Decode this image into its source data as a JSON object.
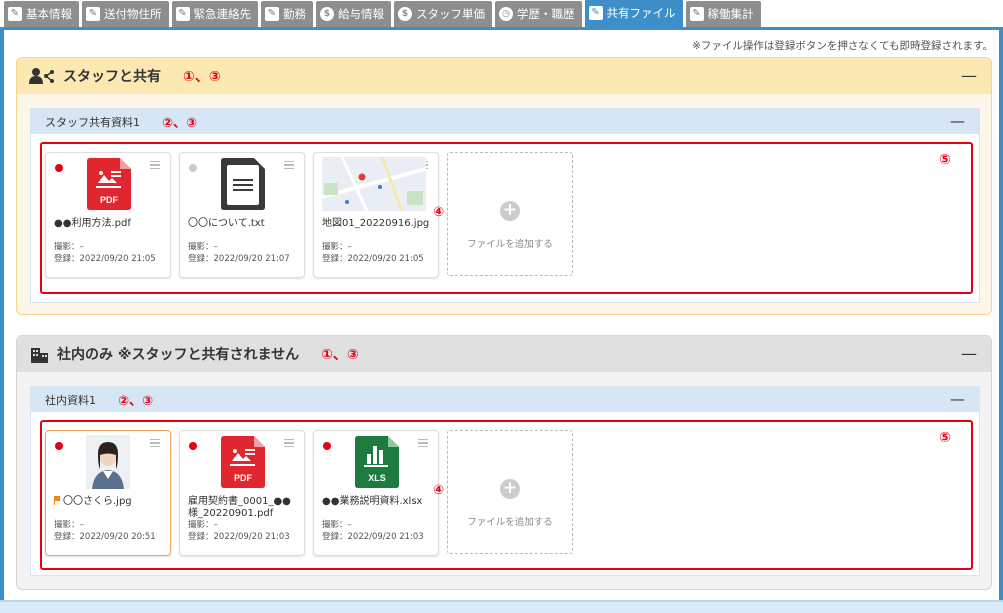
{
  "tabs": [
    {
      "label": "基本情報",
      "icon": "edit-icon"
    },
    {
      "label": "送付物住所",
      "icon": "edit-icon"
    },
    {
      "label": "緊急連絡先",
      "icon": "edit-icon"
    },
    {
      "label": "勤務",
      "icon": "edit-icon"
    },
    {
      "label": "給与情報",
      "icon": "yen-coin-icon"
    },
    {
      "label": "スタッフ単価",
      "icon": "yen-coin-icon"
    },
    {
      "label": "学歴・職歴",
      "icon": "clock-icon"
    },
    {
      "label": "共有ファイル",
      "icon": "edit-icon",
      "active": true
    },
    {
      "label": "稼働集計",
      "icon": "edit-icon"
    }
  ],
  "notice": "※ファイル操作は登録ボタンを押さなくても即時登録されます。",
  "sections": {
    "staff_shared": {
      "title": "スタッフと共有",
      "marker": "①、③",
      "collapse": "—",
      "folder": {
        "title": "スタッフ共有資料1",
        "marker": "②、③",
        "collapse": "—",
        "box_marker": "⑤",
        "add_marker": "④",
        "add_label": "ファイルを追加する",
        "files": [
          {
            "name": "●●利用方法.pdf",
            "shot": "撮影：–",
            "registered": "登録：2022/09/20 21:05",
            "type": "pdf-icon",
            "dot": "red"
          },
          {
            "name": "〇〇について.txt",
            "shot": "撮影：–",
            "registered": "登録：2022/09/20 21:07",
            "type": "txt-icon",
            "dot": "grey"
          },
          {
            "name": "地図01_20220916.jpg",
            "shot": "撮影：–",
            "registered": "登録：2022/09/20 21:05",
            "type": "map-thumbnail",
            "dot": "grey"
          }
        ]
      }
    },
    "internal_only": {
      "title": "社内のみ ※スタッフと共有されません",
      "marker": "①、③",
      "collapse": "—",
      "folder": {
        "title": "社内資料1",
        "marker": "②、③",
        "collapse": "—",
        "box_marker": "⑤",
        "add_marker": "④",
        "add_label": "ファイルを追加する",
        "files": [
          {
            "name": "〇〇さくら.jpg",
            "shot": "撮影：–",
            "registered": "登録：2022/09/20 20:51",
            "type": "photo-thumbnail",
            "dot": "red"
          },
          {
            "name": "雇用契約書_0001_●●様_20220901.pdf",
            "shot": "撮影：–",
            "registered": "登録：2022/09/20 21:03",
            "type": "pdf-icon",
            "dot": "red"
          },
          {
            "name": "●●業務説明資料.xlsx",
            "shot": "撮影：–",
            "registered": "登録：2022/09/20 21:03",
            "type": "xls-icon",
            "dot": "red"
          }
        ]
      }
    }
  },
  "icon_labels": {
    "pdf": "PDF",
    "xls": "XLS"
  },
  "colors": {
    "tab_active": "#3e8fc9",
    "tab": "#8e8e8e",
    "marker": "#e60012",
    "pdf": "#e0262e",
    "xls": "#1e7b3f"
  }
}
